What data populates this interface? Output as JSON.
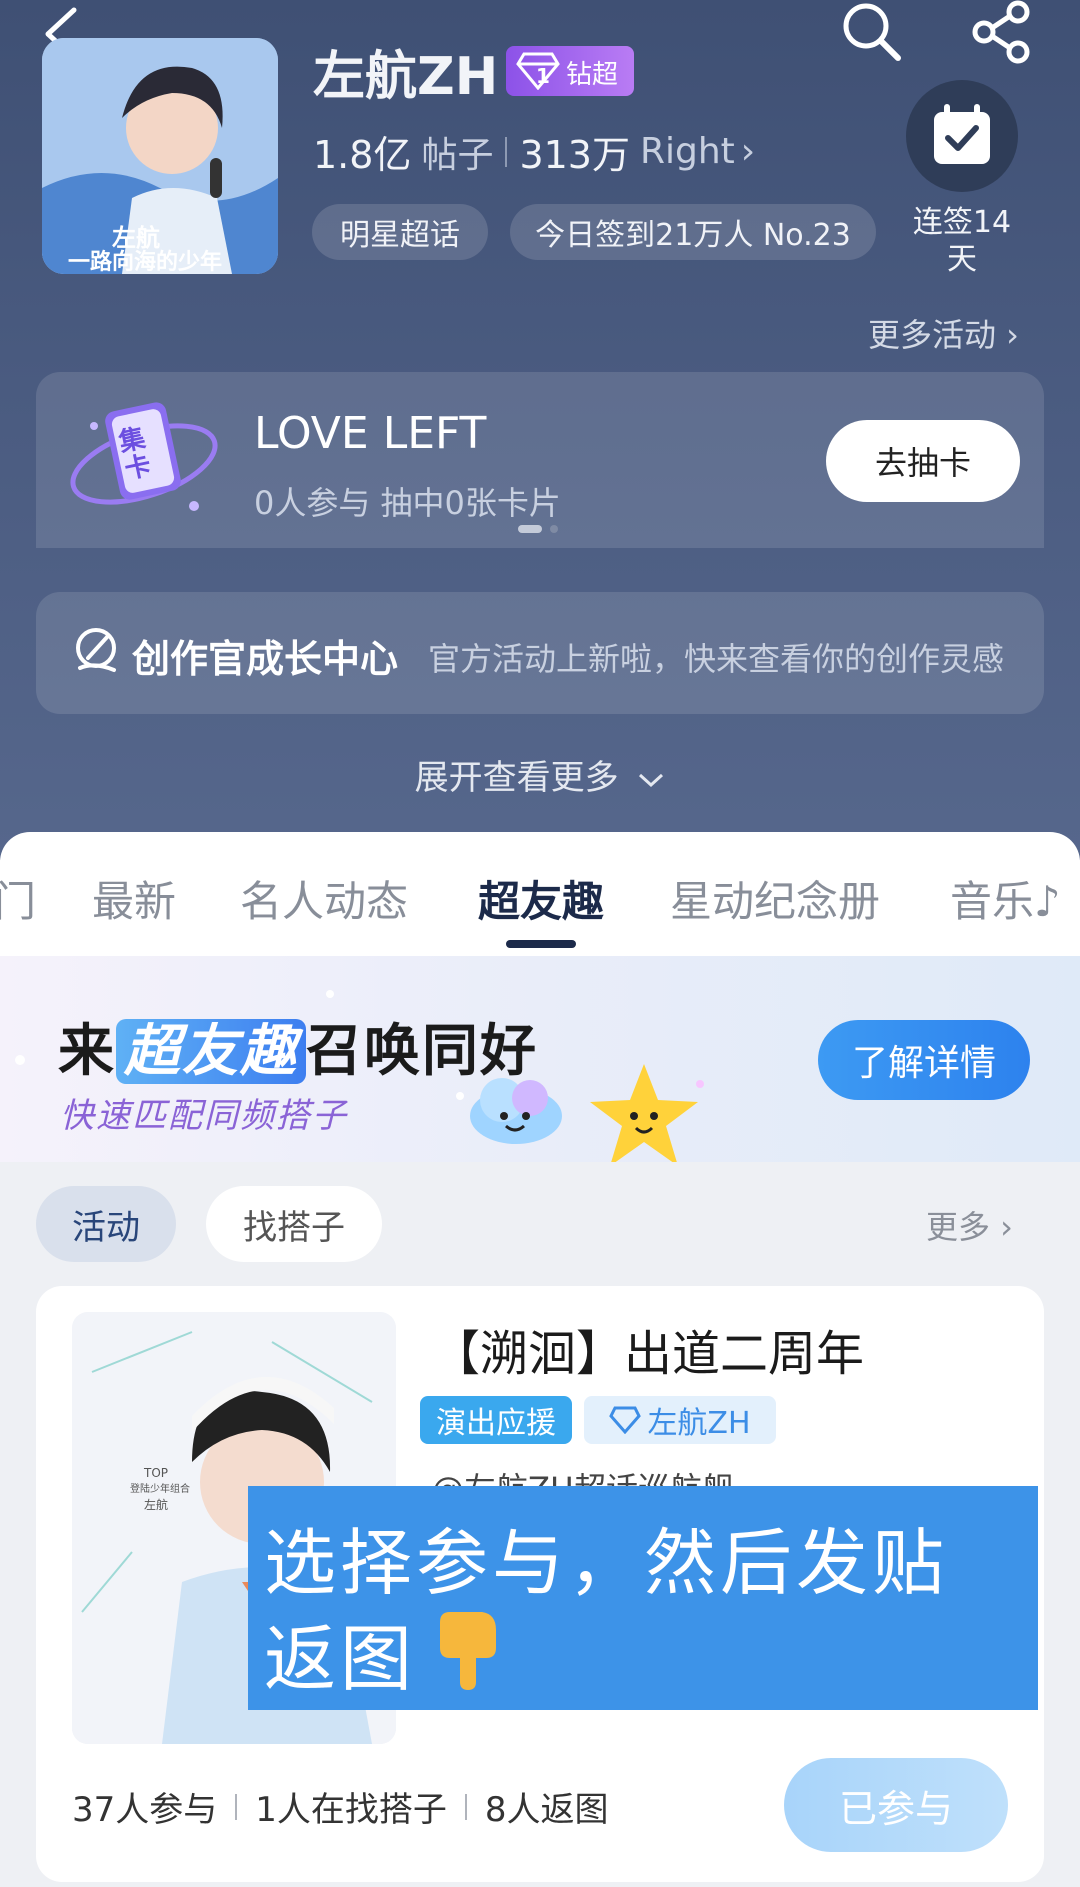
{
  "header": {
    "title": "左航ZH",
    "badge": "钻超",
    "badge_level": "1",
    "posts_count": "1.8亿",
    "posts_label": "帖子",
    "fans_count": "313万",
    "fans_label": "Right",
    "fans_arrow": "›",
    "category_pill": "明星超话",
    "checkin_pill": "今日签到21万人 No.23",
    "checkin_streak": "连签14天",
    "more_activities": "更多活动 ›",
    "avatar_caption_1": "左航",
    "avatar_caption_2": "一路向海的少年"
  },
  "activity_card": {
    "title": "LOVE LEFT",
    "subtitle": "0人参与 抽中0张卡片",
    "button": "去抽卡",
    "icon_text": "集卡",
    "page_index": 1,
    "page_count": 2
  },
  "creator_center": {
    "title": "创作官成长中心",
    "desc": "官方活动上新啦，快来查看你的创作灵感"
  },
  "expand_more": "展开查看更多",
  "tabs": [
    {
      "label": "门",
      "active": false
    },
    {
      "label": "最新",
      "active": false
    },
    {
      "label": "名人动态",
      "active": false
    },
    {
      "label": "超友趣",
      "active": true
    },
    {
      "label": "星动纪念册",
      "active": false
    },
    {
      "label": "音乐♪",
      "active": false
    }
  ],
  "banner": {
    "prefix": "来",
    "highlight": "超友趣",
    "suffix": "召唤同好",
    "subtitle": "快速匹配同频搭子",
    "button": "了解详情"
  },
  "filter": {
    "chip_active": "活动",
    "chip_other": "找搭子",
    "more": "更多 ›"
  },
  "event": {
    "title": "【溯洄】出道二周年",
    "tag1": "演出应援",
    "tag2": "左航ZH",
    "author": "@左航ZH超话巡航舰",
    "img_caption_1": "TOP",
    "img_caption_2": "登陆少年组合",
    "img_caption_3": "左航",
    "overlay_line1": "选择参与，然后发贴",
    "overlay_line2": "返图",
    "stats": [
      "37人参与",
      "1人在找搭子",
      "8人返图"
    ],
    "joined_button": "已参与"
  },
  "colors": {
    "header_bg": "#4a5b80",
    "tab_active": "#1c2a4a",
    "accent_blue": "#3d93e8",
    "badge_purple": "#9b5cf0"
  }
}
